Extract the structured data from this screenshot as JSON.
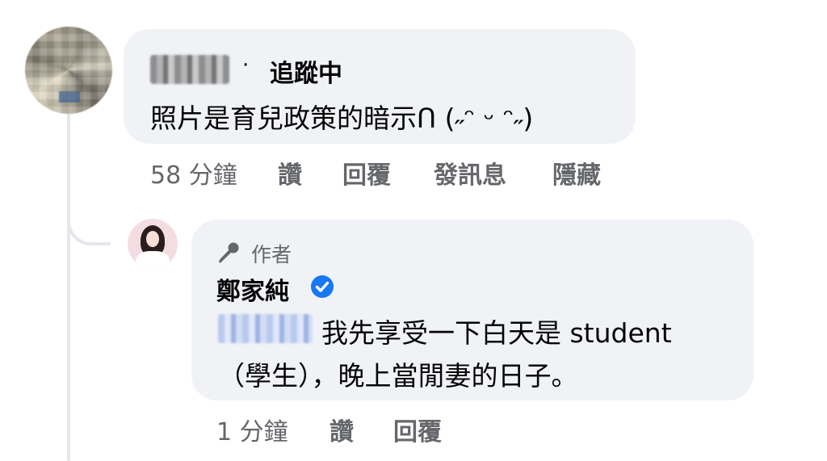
{
  "comment1": {
    "follow_separator": "·",
    "follow_label": "追蹤中",
    "text": "照片是育兒政策的暗示ᑎ (˶ᵔ ᵕ ᵔ˶)",
    "actions": {
      "time": "58 分鐘",
      "like": "讚",
      "reply": "回覆",
      "message": "發訊息",
      "hide": "隱藏"
    }
  },
  "reply1": {
    "author_badge_label": "作者",
    "author_name": "鄭家純",
    "text_line1": "我先享受一下白天是 student",
    "text_line2": "（學生），晚上當閒妻的日子。",
    "actions": {
      "time": "1 分鐘",
      "like": "讚",
      "reply": "回覆"
    }
  },
  "colors": {
    "bubble": "#f0f2f5",
    "secondary_text": "#65676b",
    "verified": "#1877f2",
    "thread_line": "#e4e6eb"
  },
  "icons": [
    "microphone-icon",
    "verified-badge-icon"
  ]
}
